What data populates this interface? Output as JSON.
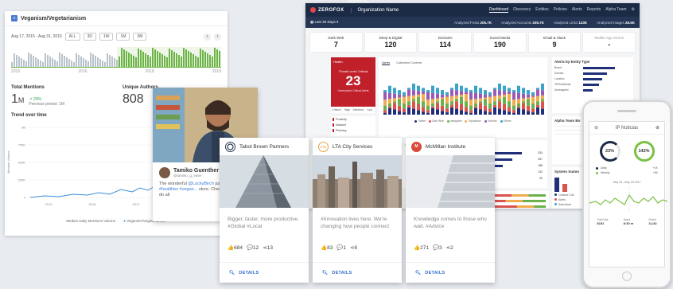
{
  "left_panel": {
    "title": "Veganism/Vegetarianism",
    "date_range": "Aug 17, 2015 - Aug 31, 2019",
    "range_buttons": [
      "ALL",
      "3D",
      "1W",
      "1M",
      "3M"
    ],
    "timeline_years": [
      "2015",
      "2016",
      "2018",
      "2019"
    ],
    "total_mentions_label": "Total Mentions",
    "total_mentions_value": "1",
    "total_mentions_unit": "M",
    "change": "↗ 20%",
    "previous_period": "Previous period: 1M",
    "unique_authors_label": "Unique Authors",
    "unique_authors_value": "808",
    "trend_label": "Trend over time",
    "y_ticks": [
      "1M",
      "750K",
      "500K",
      "250K",
      "0"
    ],
    "x_ticks": [
      "2015",
      "2016",
      "2017",
      "2018"
    ],
    "y_axis_label": "Mention Volume",
    "point_label": "A",
    "legend": [
      "Median Daily Mentions Volume",
      "Veganism/Vegetarianism"
    ],
    "accent": "#3b8fd8"
  },
  "dashboard": {
    "brand": "ZEROFOX",
    "org": "Organization Name",
    "nav": [
      "Dashboard",
      "Discovery",
      "Entities",
      "Policies",
      "Alerts",
      "Reports",
      "Alpha Team"
    ],
    "range": "Last 30 Days",
    "stats": [
      {
        "label": "Analyzed Posts",
        "value": "205.7K"
      },
      {
        "label": "Analyzed Accounts",
        "value": "205.7K"
      },
      {
        "label": "Analyzed Links",
        "value": "123K"
      },
      {
        "label": "Analyzed Images",
        "value": "26.5K"
      }
    ],
    "cards": [
      {
        "title": "Dark Web",
        "value": "7"
      },
      {
        "title": "Deep & Digital",
        "value": "120"
      },
      {
        "title": "Domains",
        "value": "114"
      },
      {
        "title": "Social Media",
        "value": "190"
      },
      {
        "title": "Email & Slack",
        "value": "9"
      },
      {
        "title": "Mobile App Stores",
        "value": "-"
      }
    ],
    "threat": {
      "header": "Health",
      "label": "Threat Level: Critical",
      "value": "23",
      "sub": "Unresolved Critical Alerts",
      "tabs": [
        "Critical",
        "High",
        "Medium",
        "Low"
      ],
      "list": [
        "Profanity",
        "Malware",
        "Phishing"
      ]
    },
    "alerts_tabs": [
      "Alerts",
      "Collected Content"
    ],
    "alerts_legend": [
      "Twitter",
      "Dark Web",
      "Instagram",
      "Tripadvisor",
      "Youtube",
      "Others"
    ],
    "entity_tabs": [
      "Top Entities",
      "Top Terms"
    ],
    "entity_values": [
      "333",
      "257",
      "188",
      "132",
      "93"
    ],
    "alerts_by_entity_title": "Alerts by Entity Type",
    "alerts_by_entity": [
      "Brand",
      "Domain",
      "Location",
      "VIP/Individual",
      "Unassigned"
    ],
    "alpha_title": "Alpha Team Bo",
    "system_title": "System Summ",
    "system_legend": [
      "Content Coll",
      "Alerts",
      "Selections"
    ]
  },
  "tweet": {
    "name": "Tamiko Guenther",
    "handle": "@tamiko_g_eater",
    "text_a": "The wonderful ",
    "mention": "@LuckyBirch",
    "text_b": " just 100% ",
    "hashtag": "#healthier #vegan...",
    "text_c": " store. Check it out! Gonna do all"
  },
  "feeds": [
    {
      "name": "Tabol Brown Partners",
      "logo_text": "",
      "logo_color": "#ffffff",
      "text": "Bigger, faster, more productive. #Global #Local",
      "likes": "684",
      "comments": "12",
      "shares": "13",
      "details": "DETAILS"
    },
    {
      "name": "LTA City Services",
      "logo_text": "LTA",
      "logo_color": "#e7a43a",
      "text": "#Innovation lives here. We're changing how people connect",
      "likes": "83",
      "comments": "1",
      "shares": "6",
      "details": "DETAILS"
    },
    {
      "name": "McMillan Institute",
      "logo_text": "M",
      "logo_color": "#d94a3a",
      "text": "Knowledge comes to those who wait. #Advice",
      "likes": "271",
      "comments": "3",
      "shares": "2",
      "details": "DETAILS"
    }
  ],
  "phone": {
    "title": "IP Noticias",
    "ring1": "23%",
    "ring2": "142%",
    "legend": [
      {
        "label": "Daily",
        "value": "+1K"
      },
      {
        "label": "Weekly",
        "value": "+6K"
      }
    ],
    "date": "May 26 - May 28 2017",
    "footer": [
      {
        "label": "Total Vals",
        "value": "$151"
      },
      {
        "label": "Spent",
        "value": "8:30 m"
      },
      {
        "label": "Reach",
        "value": "3,143"
      }
    ]
  }
}
